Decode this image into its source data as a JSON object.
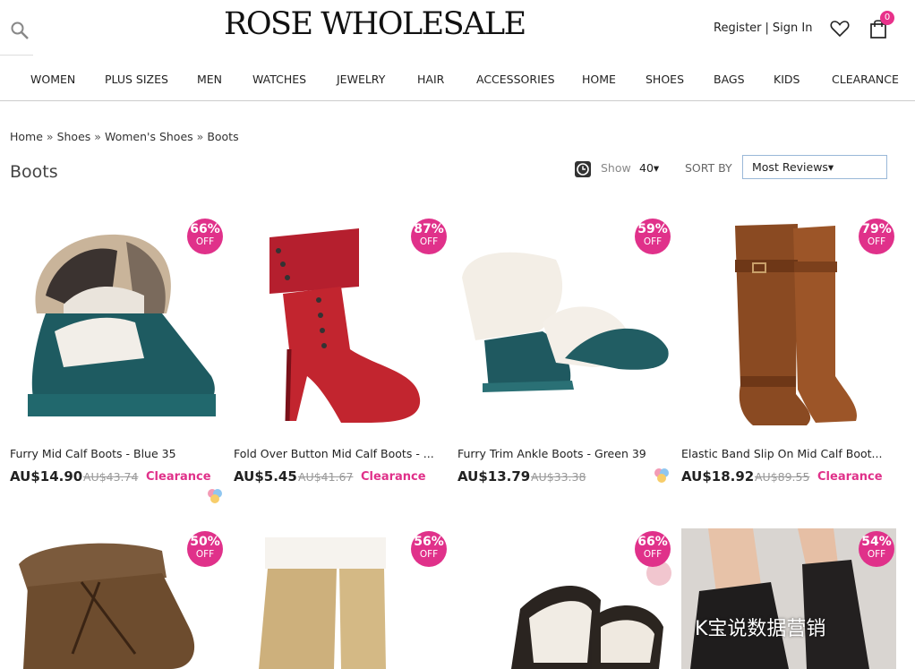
{
  "header": {
    "logo": "ROSE WHOLESALE",
    "register": "Register",
    "sign_in": "Sign In",
    "separator": "|",
    "cart_count": "0"
  },
  "nav": [
    "WOMEN",
    "PLUS SIZES",
    "MEN",
    "WATCHES",
    "JEWELRY",
    "HAIR",
    "ACCESSORIES",
    "HOME",
    "SHOES",
    "BAGS",
    "KIDS",
    "CLEARANCE"
  ],
  "breadcrumb": [
    "Home",
    "Shoes",
    "Women's Shoes",
    "Boots"
  ],
  "breadcrumb_sep": "»",
  "page_title": "Boots",
  "toolbar": {
    "show_label": "Show",
    "show_value": "40▾",
    "sort_label": "SORT BY",
    "sort_value": "Most Reviews▾"
  },
  "products": [
    {
      "pct": "66%",
      "off": "OFF",
      "name": "Furry Mid Calf Boots - Blue 35",
      "price": "AU$14.90",
      "old": "AU$43.74",
      "tag": "Clearance"
    },
    {
      "pct": "87%",
      "off": "OFF",
      "name": "Fold Over Button Mid Calf Boots - ...",
      "price": "AU$5.45",
      "old": "AU$41.67",
      "tag": "Clearance"
    },
    {
      "pct": "59%",
      "off": "OFF",
      "name": "Furry Trim Ankle Boots - Green 39",
      "price": "AU$13.79",
      "old": "AU$33.38",
      "tag": ""
    },
    {
      "pct": "79%",
      "off": "OFF",
      "name": "Elastic Band Slip On Mid Calf Boot...",
      "price": "AU$18.92",
      "old": "AU$89.55",
      "tag": "Clearance"
    },
    {
      "pct": "50%",
      "off": "OFF"
    },
    {
      "pct": "56%",
      "off": "OFF"
    },
    {
      "pct": "66%",
      "off": "OFF"
    },
    {
      "pct": "54%",
      "off": "OFF"
    }
  ],
  "watermark": "K宝说数据营销",
  "colors": {
    "accent": "#e0318a",
    "sort_border": "#9ab8d8"
  }
}
